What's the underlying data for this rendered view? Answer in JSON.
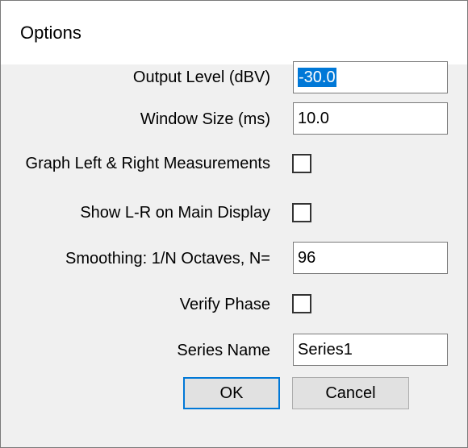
{
  "dialog": {
    "title": "Options"
  },
  "fields": {
    "output_level": {
      "label": "Output Level (dBV)",
      "value": "-30.0"
    },
    "window_size": {
      "label": "Window Size (ms)",
      "value": "10.0"
    },
    "graph_lr": {
      "label": "Graph Left & Right Measurements",
      "checked": false
    },
    "show_lr": {
      "label": "Show L-R on Main Display",
      "checked": false
    },
    "smoothing": {
      "label": "Smoothing: 1/N Octaves, N=",
      "value": "96"
    },
    "verify_phase": {
      "label": "Verify Phase",
      "checked": false
    },
    "series_name": {
      "label": "Series Name",
      "value": "Series1"
    }
  },
  "buttons": {
    "ok": "OK",
    "cancel": "Cancel"
  }
}
